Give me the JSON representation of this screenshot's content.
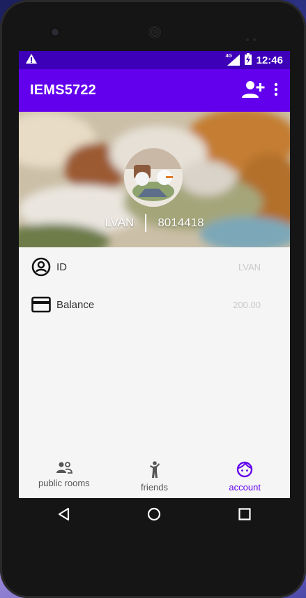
{
  "status_bar": {
    "warning_icon": "warning-triangle-icon",
    "network": "4G",
    "time": "12:46"
  },
  "app_bar": {
    "title": "IEMS5722",
    "add_friend_icon": "person-add-icon",
    "more_icon": "more-vertical-icon"
  },
  "profile": {
    "name": "LVAN",
    "number": "8014418"
  },
  "details": [
    {
      "icon": "account-circle-icon",
      "label": "ID",
      "value": "LVAN"
    },
    {
      "icon": "credit-card-icon",
      "label": "Balance",
      "value": "200.00"
    }
  ],
  "bottom_nav": [
    {
      "icon": "people-icon",
      "label": "public rooms",
      "active": false
    },
    {
      "icon": "person-standing-icon",
      "label": "friends",
      "active": false
    },
    {
      "icon": "face-icon",
      "label": "account",
      "active": true
    }
  ],
  "colors": {
    "primary": "#6200ee",
    "primary_dark": "#3d00b8",
    "background": "#f5f5f5"
  }
}
